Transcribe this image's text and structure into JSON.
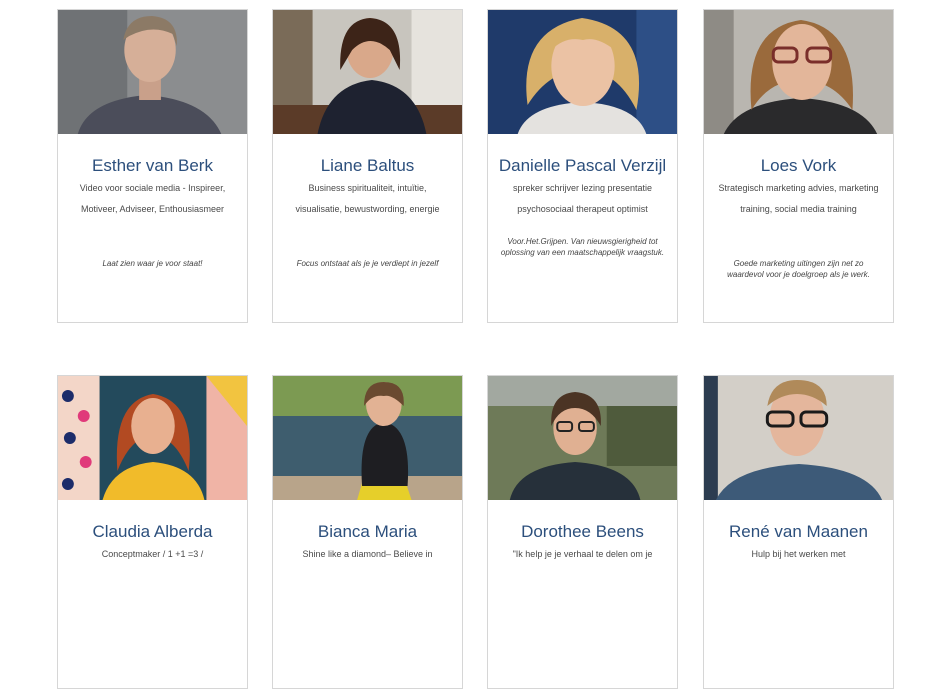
{
  "people": [
    {
      "name": "Esther van Berk",
      "desc": "Video voor sociale media - Inspireer, Motiveer, Adviseer, Enthousiasmeer",
      "quote": "Laat zien waar je voor staat!"
    },
    {
      "name": "Liane Baltus",
      "desc": "Business spiritualiteit, intuïtie, visualisatie, bewustwording, energie",
      "quote": "Focus ontstaat als je je verdiept in jezelf"
    },
    {
      "name": "Danielle Pascal Verzijl",
      "desc": "spreker schrijver lezing presentatie psychosociaal therapeut optimist",
      "quote": "Voor.Het.Grijpen. Van nieuwsgierigheid tot oplossing van een maatschappelijk vraagstuk."
    },
    {
      "name": "Loes Vork",
      "desc": "Strategisch marketing advies, marketing training, social media training",
      "quote": "Goede marketing uitingen zijn net zo waardevol voor je doelgroep als je werk."
    },
    {
      "name": "Claudia Alberda",
      "desc": "Conceptmaker / 1 +1 =3 /"
    },
    {
      "name": "Bianca Maria",
      "desc": "Shine like a diamond– Believe in"
    },
    {
      "name": "Dorothee Beens",
      "desc": "\"Ik help je je verhaal te delen om je"
    },
    {
      "name": "René van Maanen",
      "desc": "Hulp bij het werken met"
    }
  ]
}
